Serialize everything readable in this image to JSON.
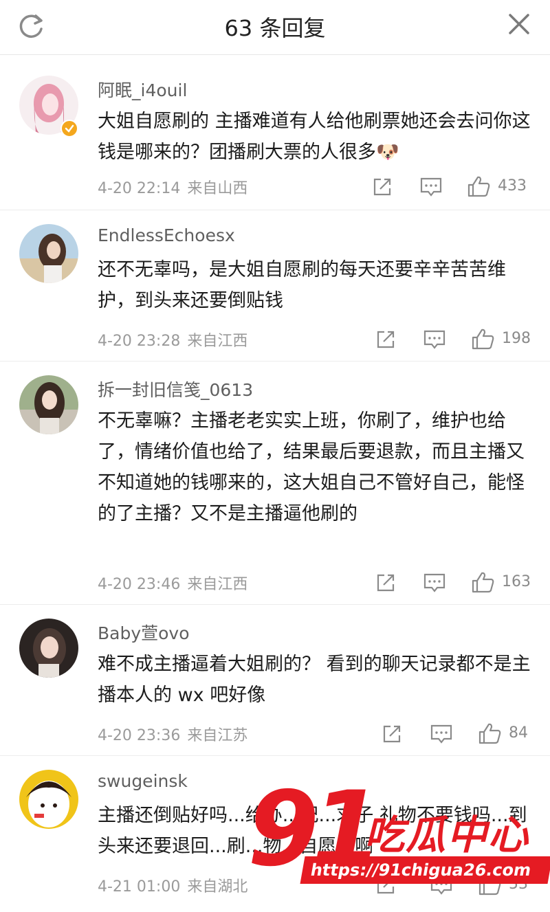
{
  "header": {
    "title": "63 条回复"
  },
  "comments": [
    {
      "name": "阿眠_i4ouil",
      "text": "大姐自愿刷的 主播难道有人给他刷票她还会去问你这钱是哪来的？团播刷大票的人很多🐶",
      "time": "4-20 22:14",
      "location": "来自山西",
      "likes": "433"
    },
    {
      "name": "EndlessEchoesx",
      "text": "还不无辜吗，是大姐自愿刷的每天还要辛辛苦苦维护，到头来还要倒贴钱",
      "time": "4-20 23:28",
      "location": "来自江西",
      "likes": "198"
    },
    {
      "name": "拆一封旧信笺_0613",
      "text": "不无辜嘛？主播老老实实上班，你刷了，维护也给了，情绪价值也给了，结果最后要退款，而且主播又不知道她的钱哪来的，这大姐自己不管好自己，能怪的了主播？又不是主播逼他刷的",
      "time": "4-20 23:46",
      "location": "来自江西",
      "likes": "163"
    },
    {
      "name": "Baby萱ovo",
      "text": "难不成主播逼着大姐刷的？ 看到的聊天记录都不是主播本人的 wx 吧好像",
      "time": "4-20 23:36",
      "location": "来自江苏",
      "likes": "84"
    },
    {
      "name": "swugeinsk",
      "text": "主播还倒贴好吗...给办...纪...求子 礼物不要钱吗...到头来还要退回...刷...物...自愿刷啊",
      "time": "4-21 01:00",
      "location": "来自湖北",
      "likes": "53"
    }
  ],
  "watermark": {
    "number": "91",
    "brand": "吃瓜中心",
    "url": "https://91chigua26.com"
  }
}
